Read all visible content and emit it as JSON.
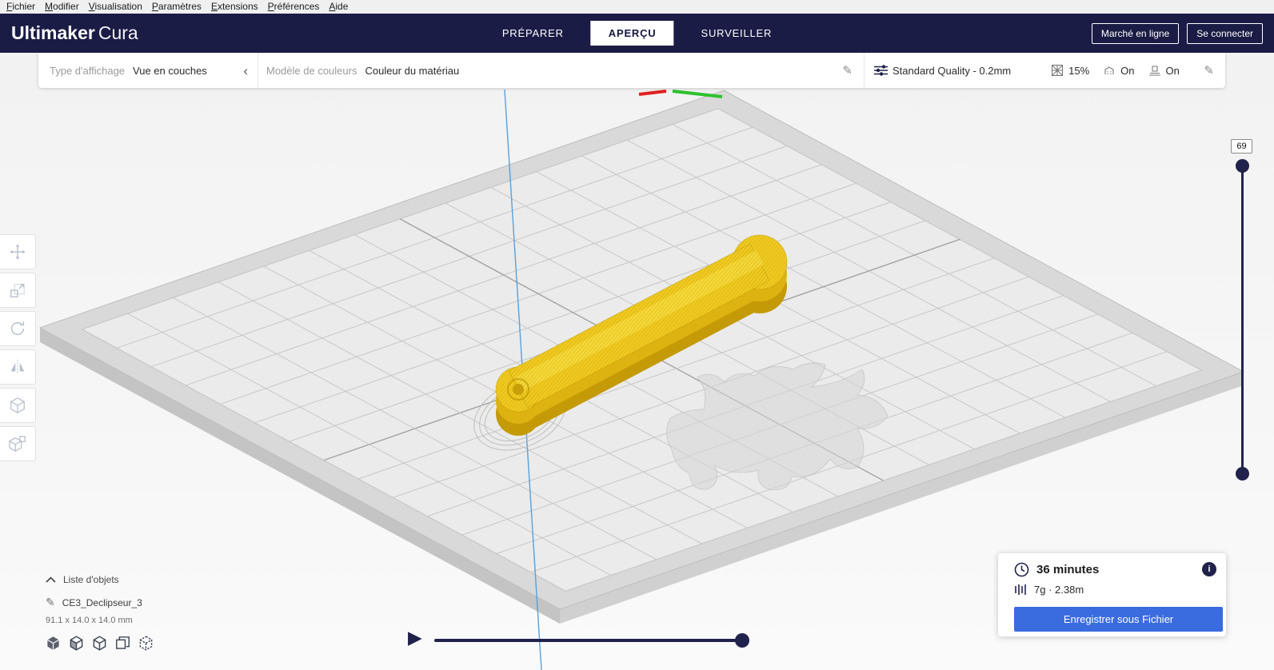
{
  "menu": {
    "items": [
      {
        "label": "Fichier"
      },
      {
        "label": "Modifier"
      },
      {
        "label": "Visualisation"
      },
      {
        "label": "Paramètres"
      },
      {
        "label": "Extensions"
      },
      {
        "label": "Préférences"
      },
      {
        "label": "Aide"
      }
    ]
  },
  "header": {
    "logo_bold": "Ultimaker",
    "logo_light": "Cura",
    "tabs": [
      {
        "label": "PRÉPARER"
      },
      {
        "label": "APERÇU"
      },
      {
        "label": "SURVEILLER"
      }
    ],
    "active_tab": "APERÇU",
    "marketplace_label": "Marché en ligne",
    "signin_label": "Se connecter"
  },
  "view_toolbar": {
    "display_type_label": "Type d'affichage",
    "display_type_value": "Vue en couches",
    "color_scheme_label": "Modèle de couleurs",
    "color_scheme_value": "Couleur du matériau"
  },
  "print_settings": {
    "profile": "Standard Quality - 0.2mm",
    "infill": "15%",
    "support": "On",
    "adhesion": "On"
  },
  "layer_slider": {
    "current_layer": "69"
  },
  "object_panel": {
    "list_label": "Liste d'objets",
    "object_name": "CE3_Declipseur_3",
    "dimensions": "91.1 x 14.0 x 14.0 mm"
  },
  "output": {
    "time": "36 minutes",
    "material": "7g · 2.38m",
    "save_button": "Enregistrer sous Fichier"
  },
  "icons": {
    "pencil": "✎",
    "chevron_left": "‹",
    "play": "▶",
    "info": "i"
  },
  "colors": {
    "header_navy": "#1a1c45",
    "accent_blue": "#3a6bdf",
    "model_yellow": "#efc91f",
    "axis_z_blue": "#4f9fdd",
    "axis_x_red": "#e02020",
    "axis_y_green": "#2ec22e"
  }
}
